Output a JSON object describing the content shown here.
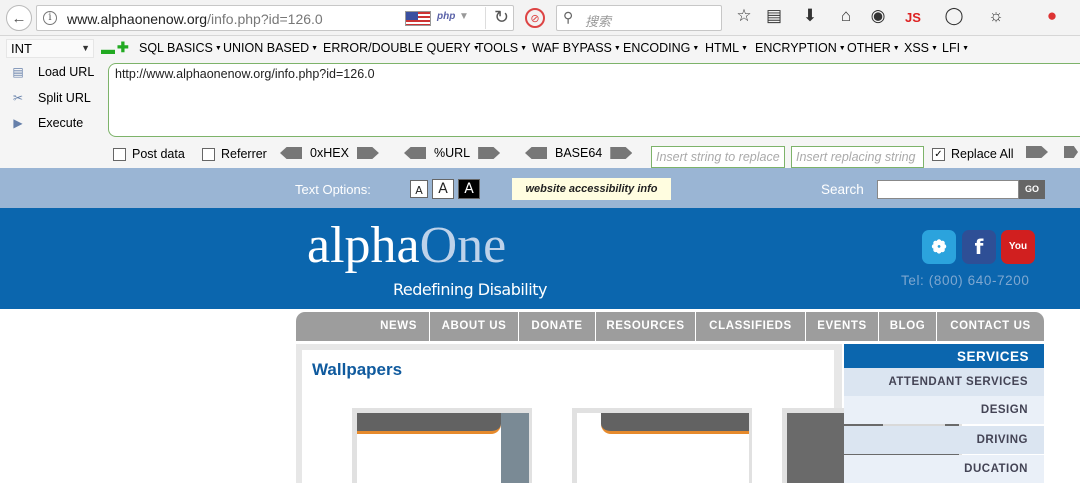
{
  "browser": {
    "url_domain": "www.alphaonenow.org",
    "url_path": "/info.php?id=126.0",
    "php_badge": "php",
    "search_placeholder": "搜索",
    "js_badge": "JS"
  },
  "hackbar": {
    "select_value": "INT",
    "menus": [
      "SQL BASICS",
      "UNION BASED",
      "ERROR/DOUBLE QUERY",
      "TOOLS",
      "WAF BYPASS",
      "ENCODING",
      "HTML",
      "ENCRYPTION",
      "OTHER",
      "XSS",
      "LFI"
    ],
    "load_url": "Load URL",
    "split_url": "Split URL",
    "execute": "Execute",
    "url_value": "http://www.alphaonenow.org/info.php?id=126.0",
    "post_data": "Post data",
    "referrer": "Referrer",
    "hex": "0xHEX",
    "url_enc": "%URL",
    "base64": "BASE64",
    "insert_string_placeholder": "Insert string to replace",
    "insert_replacing_placeholder": "Insert replacing string",
    "replace_all": "Replace All",
    "replace_all_checked": true
  },
  "site": {
    "text_options_label": "Text Options:",
    "size_labels": [
      "A",
      "A",
      "A"
    ],
    "accessibility": "website accessibility info",
    "search_label": "Search",
    "go": "GO",
    "logo_alpha": "alpha",
    "logo_one": "One",
    "tagline": "Redefining Disability",
    "tel": "Tel: (800) 640-7200",
    "social": [
      "twitter",
      "facebook",
      "youtube"
    ],
    "nav": [
      "NEWS",
      "ABOUT US",
      "DONATE",
      "RESOURCES",
      "CLASSIFIEDS",
      "EVENTS",
      "BLOG",
      "CONTACT US"
    ],
    "page_heading": "Wallpapers",
    "services_heading": "SERVICES",
    "services": [
      "ATTENDANT SERVICES",
      "DESIGN",
      "DRIVING",
      "DUCATION"
    ]
  }
}
